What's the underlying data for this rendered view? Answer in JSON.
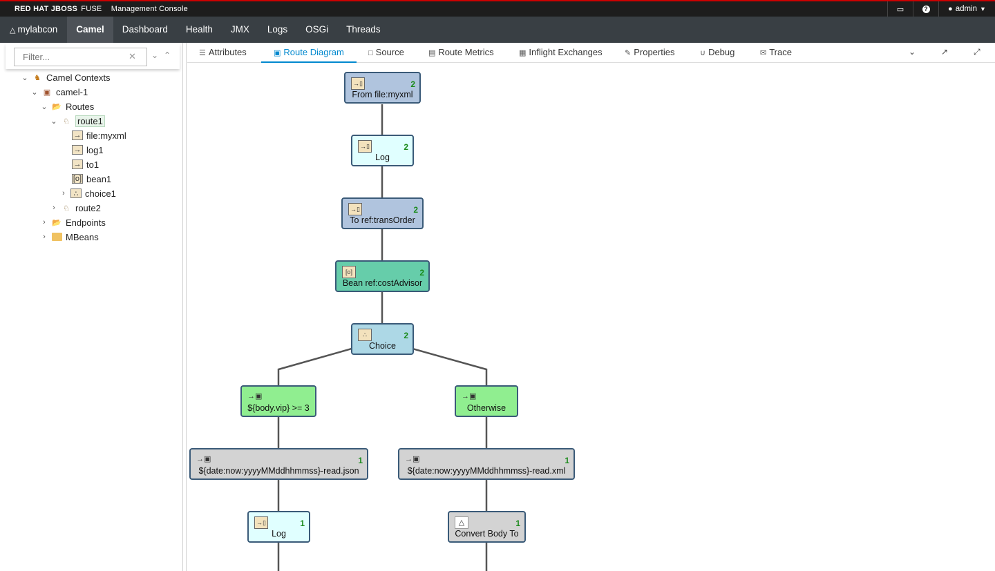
{
  "brand": {
    "redhat": "RED HAT JBOSS",
    "fuse": "FUSE",
    "console": "Management Console"
  },
  "utility": {
    "monitor_icon": "monitor-icon",
    "help_icon": "help-icon",
    "user_label": "admin"
  },
  "nav": {
    "context": "mylabcon",
    "items": [
      "Camel",
      "Dashboard",
      "Health",
      "JMX",
      "Logs",
      "OSGi",
      "Threads"
    ],
    "active": "Camel"
  },
  "sidebar": {
    "filter_placeholder": "Filter...",
    "tree": {
      "camel_contexts": "Camel Contexts",
      "context": "camel-1",
      "routes": "Routes",
      "route1": "route1",
      "route1_children": [
        "file:myxml",
        "log1",
        "to1",
        "bean1",
        "choice1"
      ],
      "route2": "route2",
      "endpoints": "Endpoints",
      "mbeans": "MBeans"
    }
  },
  "tabs": {
    "items": [
      "Attributes",
      "Route Diagram",
      "Source",
      "Route Metrics",
      "Inflight Exchanges",
      "Properties",
      "Debug",
      "Trace"
    ],
    "active": "Route Diagram"
  },
  "diagram": {
    "nodes": [
      {
        "label": "From file:myxml",
        "count": "2",
        "kind": "from"
      },
      {
        "label": "Log",
        "count": "2",
        "kind": "log"
      },
      {
        "label": "To ref:transOrder",
        "count": "2",
        "kind": "from"
      },
      {
        "label": "Bean ref:costAdvisor",
        "count": "2",
        "kind": "bean"
      },
      {
        "label": "Choice",
        "count": "2",
        "kind": "choice"
      },
      {
        "label": "${body.vip} >= 3",
        "count": "",
        "kind": "when"
      },
      {
        "label": "Otherwise",
        "count": "",
        "kind": "when"
      },
      {
        "label": "${date:now:yyyyMMddhhmmss}-read.json",
        "count": "1",
        "kind": "to"
      },
      {
        "label": "${date:now:yyyyMMddhhmmss}-read.xml",
        "count": "1",
        "kind": "to"
      },
      {
        "label": "Log",
        "count": "1",
        "kind": "log"
      },
      {
        "label": "Convert Body To",
        "count": "1",
        "kind": "log"
      }
    ]
  }
}
